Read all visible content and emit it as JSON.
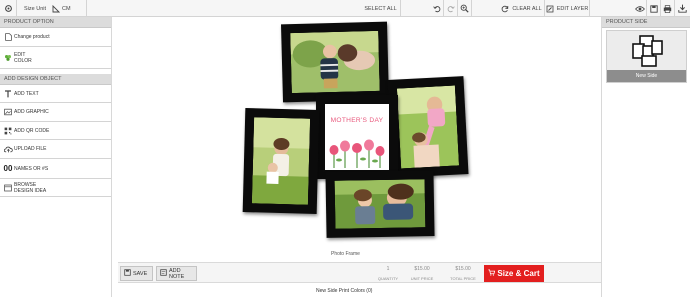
{
  "toolbar": {
    "size_unit_label": "Size Unit",
    "unit_value": "CM",
    "select_all": "SELECT ALL",
    "clear_all": "CLEAR ALL",
    "edit_layer": "EDIT LAYER",
    "icons": [
      "settings-icon",
      "ruler-icon",
      "undo-icon",
      "redo-icon",
      "zoom-in-icon",
      "refresh-icon",
      "edit-layer-icon",
      "eye-icon",
      "save-icon",
      "print-icon",
      "download-icon"
    ]
  },
  "left_panel": {
    "product_option_heading": "PRODUCT OPTION",
    "change_product": "Change product",
    "edit_color_line1": "EDIT",
    "edit_color_line2": "COLOR",
    "add_design_heading": "ADD DESIGN OBJECT",
    "add_text": "ADD TEXT",
    "add_graphic": "ADD GRAPHIC",
    "add_qr_code": "ADD QR CODE",
    "upload_file": "UPLOAD FILE",
    "names_or_numbers": "NAMES OR #S",
    "names_icon_text": "00",
    "browse_line1": "BROWSE",
    "browse_line2": "DESIGN IDEA"
  },
  "right_panel": {
    "heading": "PRODUCT SIDE",
    "side_name": "New Side"
  },
  "canvas": {
    "caption": "Photo Frame",
    "center_text": "MOTHER'S DAY"
  },
  "bottom": {
    "save": "SAVE",
    "add_note": "ADD NOTE",
    "quantity_value": "1",
    "quantity_label": "QUANTITY",
    "unit_price_value": "$15.00",
    "unit_price_label": "UNIT PRICE",
    "total_price_value": "$15.00",
    "total_price_label": "TOTAL PRICE",
    "cart_label": "Size & Cart",
    "print_colors": "New Side Print Colors  (0)"
  },
  "colors": {
    "accent_red": "#e31f1f",
    "panel_heading": "#dcdcdc",
    "side_label_bg": "#8d8d8d"
  }
}
